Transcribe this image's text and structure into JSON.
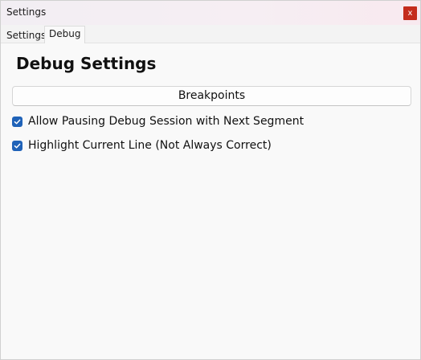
{
  "window": {
    "title": "Settings",
    "close_label": "x"
  },
  "tabs": [
    {
      "label": "Settings",
      "selected": false
    },
    {
      "label": "Debug",
      "selected": true
    }
  ],
  "debug": {
    "heading": "Debug Settings",
    "breakpoints_button": "Breakpoints",
    "options": [
      {
        "label": "Allow Pausing Debug Session with Next Segment",
        "checked": true
      },
      {
        "label": "Highlight Current Line (Not Always Correct)",
        "checked": true
      }
    ]
  },
  "colors": {
    "checkbox_accent": "#1f62b8",
    "close_button": "#c42b1c"
  },
  "icons": {
    "checkbox_mark": "checkmark-icon",
    "close": "close-icon"
  }
}
